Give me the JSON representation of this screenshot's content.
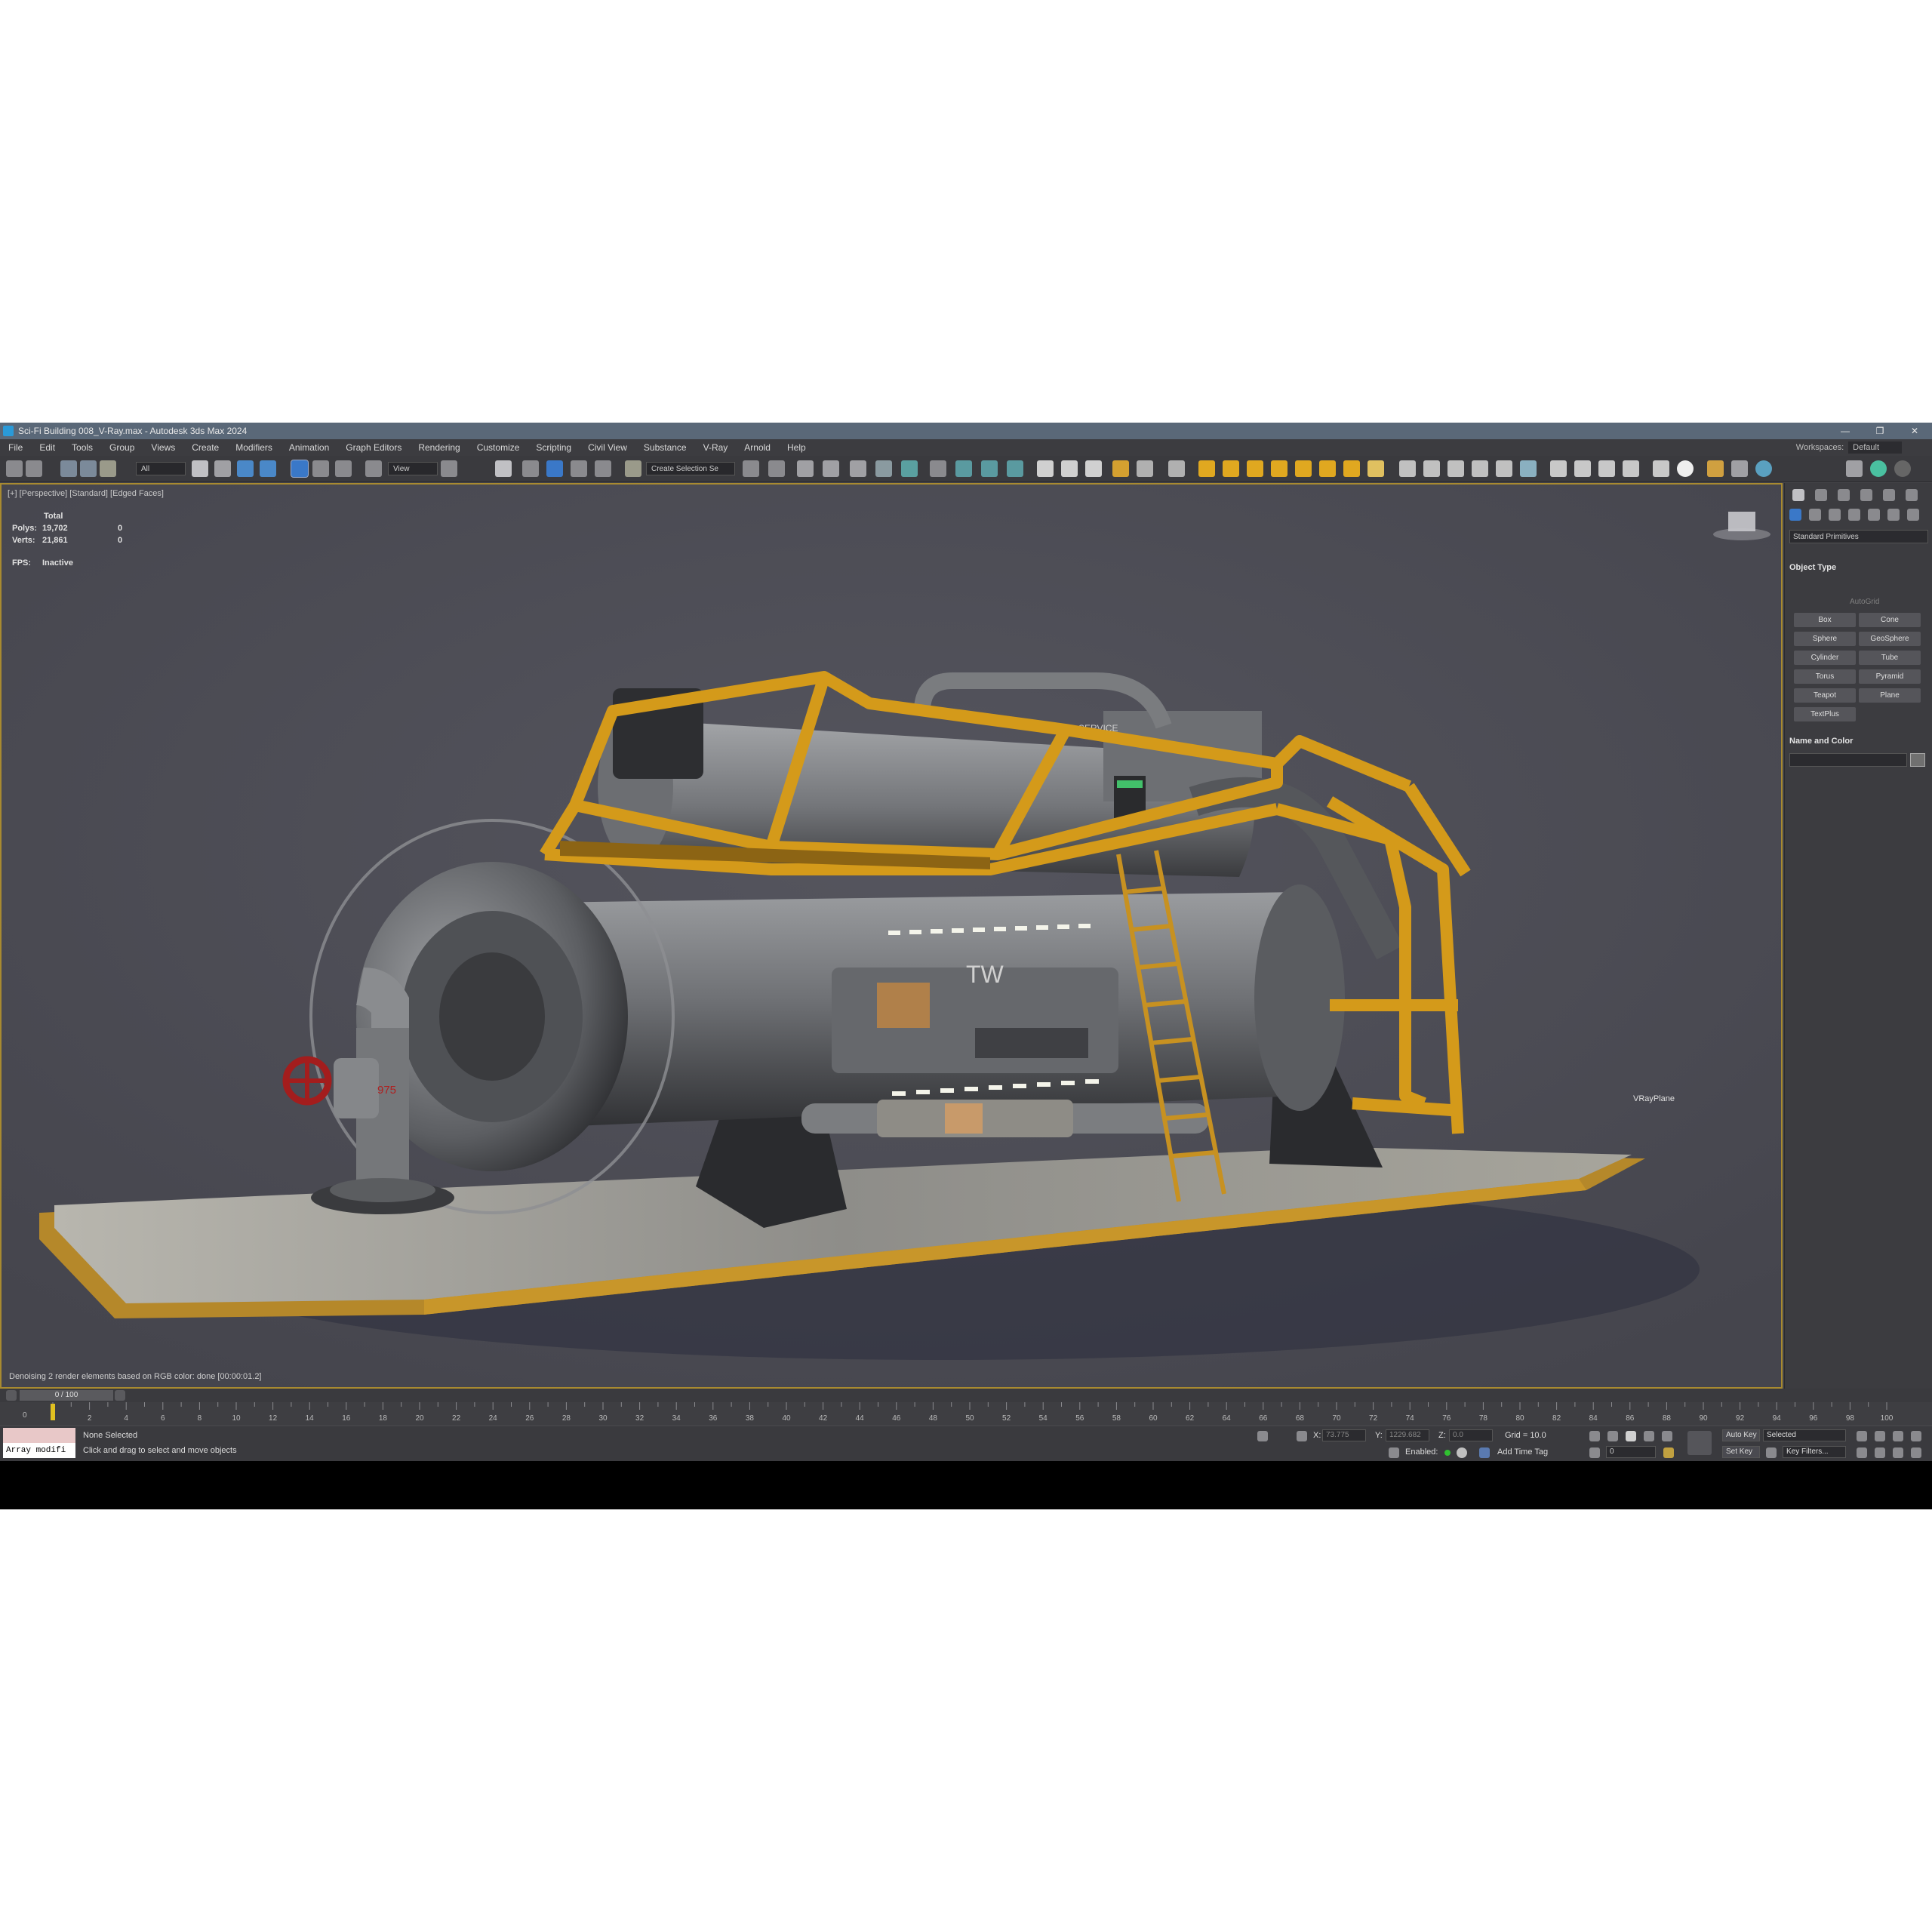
{
  "window": {
    "title": "Sci-Fi Building 008_V-Ray.max - Autodesk 3ds Max 2024",
    "min_glyph": "—",
    "restore_glyph": "❐",
    "close_glyph": "✕"
  },
  "menu": {
    "items": [
      "File",
      "Edit",
      "Tools",
      "Group",
      "Views",
      "Create",
      "Modifiers",
      "Animation",
      "Graph Editors",
      "Rendering",
      "Customize",
      "Scripting",
      "Civil View",
      "Substance",
      "V-Ray",
      "Arnold",
      "Help"
    ],
    "workspaces_label": "Workspaces:",
    "workspaces_value": "Default"
  },
  "toolbar": {
    "filter_value": "All",
    "refcoord_value": "View",
    "selection_set_value": "Create Selection Se"
  },
  "viewport": {
    "label": "[+] [Perspective] [Standard] [Edged Faces]",
    "stats_total": "Total",
    "polys_label": "Polys:",
    "polys_value": "19,702",
    "polys_sel": "0",
    "verts_label": "Verts:",
    "verts_value": "21,861",
    "verts_sel": "0",
    "fps_label": "FPS:",
    "fps_value": "Inactive",
    "vray_label": "VRayPlane",
    "status_note": "Denoising 2 render elements based on RGB color: done [00:00:01.2]",
    "model_decals": {
      "tw": "TW",
      "service": "SERVICE",
      "code": "975"
    }
  },
  "command_panel": {
    "category": "Standard Primitives",
    "object_type_title": "Object Type",
    "autogrid": "AutoGrid",
    "buttons": [
      "Box",
      "Cone",
      "Sphere",
      "GeoSphere",
      "Cylinder",
      "Tube",
      "Torus",
      "Pyramid",
      "Teapot",
      "Plane",
      "TextPlus"
    ],
    "name_color_title": "Name and Color"
  },
  "timeline": {
    "slider_label": "0 / 100",
    "ticks": [
      "0",
      "2",
      "4",
      "6",
      "8",
      "10",
      "12",
      "14",
      "16",
      "18",
      "20",
      "22",
      "24",
      "26",
      "28",
      "30",
      "32",
      "34",
      "36",
      "38",
      "40",
      "42",
      "44",
      "46",
      "48",
      "50",
      "52",
      "54",
      "56",
      "58",
      "60",
      "62",
      "64",
      "66",
      "68",
      "70",
      "72",
      "74",
      "76",
      "78",
      "80",
      "82",
      "84",
      "86",
      "88",
      "90",
      "92",
      "94",
      "96",
      "98",
      "100"
    ]
  },
  "status": {
    "maxscript": "Array modifi",
    "selection": "None Selected",
    "prompt": "Click and drag to select and move objects",
    "x_label": "X:",
    "x_value": "73.775",
    "y_label": "Y:",
    "y_value": "1229.682",
    "z_label": "Z:",
    "z_value": "0.0",
    "grid": "Grid = 10.0",
    "enabled": "Enabled:",
    "add_time_tag": "Add Time Tag",
    "auto_key": "Auto Key",
    "set_key": "Set Key",
    "key_mode": "Selected",
    "key_filters": "Key Filters...",
    "frame_value": "0"
  },
  "colors": {
    "frame_yellow": "#d49a1a",
    "metal_gray": "#6d6f72",
    "viewport_bg": "#4b4b53",
    "valve_red": "#a31d1d"
  }
}
